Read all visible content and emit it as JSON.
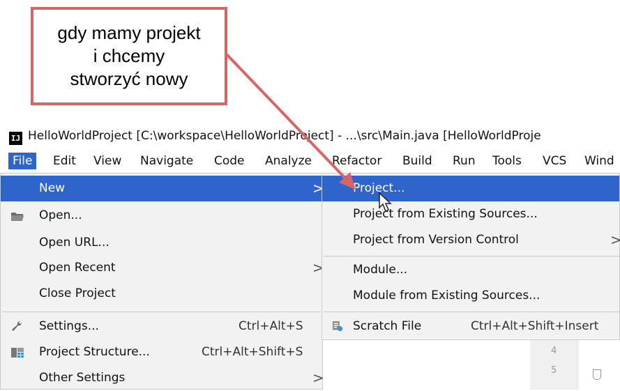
{
  "callout": {
    "lines": [
      "gdy mamy projekt",
      "i chcemy",
      "stworzyć nowy"
    ]
  },
  "window": {
    "icon_text": "IJ",
    "title": "HelloWorldProject [C:\\workspace\\HelloWorldProject] - ...\\src\\Main.java [HelloWorldProje"
  },
  "menubar": {
    "items": [
      "File",
      "Edit",
      "View",
      "Navigate",
      "Code",
      "Analyze",
      "Refactor",
      "Build",
      "Run",
      "Tools",
      "VCS",
      "Wind"
    ]
  },
  "file_menu": {
    "items": [
      {
        "label": "New",
        "submenu": ">"
      },
      {
        "label": "Open...",
        "icon": "folder-icon"
      },
      {
        "label": "Open URL..."
      },
      {
        "label": "Open Recent",
        "submenu": ">"
      },
      {
        "label": "Close Project"
      },
      {
        "label": "Settings...",
        "shortcut": "Ctrl+Alt+S",
        "icon": "wrench-icon"
      },
      {
        "label": "Project Structure...",
        "shortcut": "Ctrl+Alt+Shift+S",
        "icon": "project-structure-icon"
      },
      {
        "label": "Other Settings",
        "submenu": ">"
      }
    ]
  },
  "new_submenu": {
    "items": [
      {
        "label": "Project..."
      },
      {
        "label": "Project from Existing Sources..."
      },
      {
        "label": "Project from Version Control",
        "submenu": ">"
      },
      {
        "label": "Module..."
      },
      {
        "label": "Module from Existing Sources..."
      },
      {
        "label": "Scratch File",
        "shortcut": "Ctrl+Alt+Shift+Insert",
        "icon": "scratch-file-icon"
      }
    ]
  },
  "editor": {
    "line_numbers": [
      "4",
      "5"
    ]
  },
  "colors": {
    "accent": "#2f65ca",
    "callout_border": "#d96464",
    "menu_bg": "#f2f2f2"
  }
}
